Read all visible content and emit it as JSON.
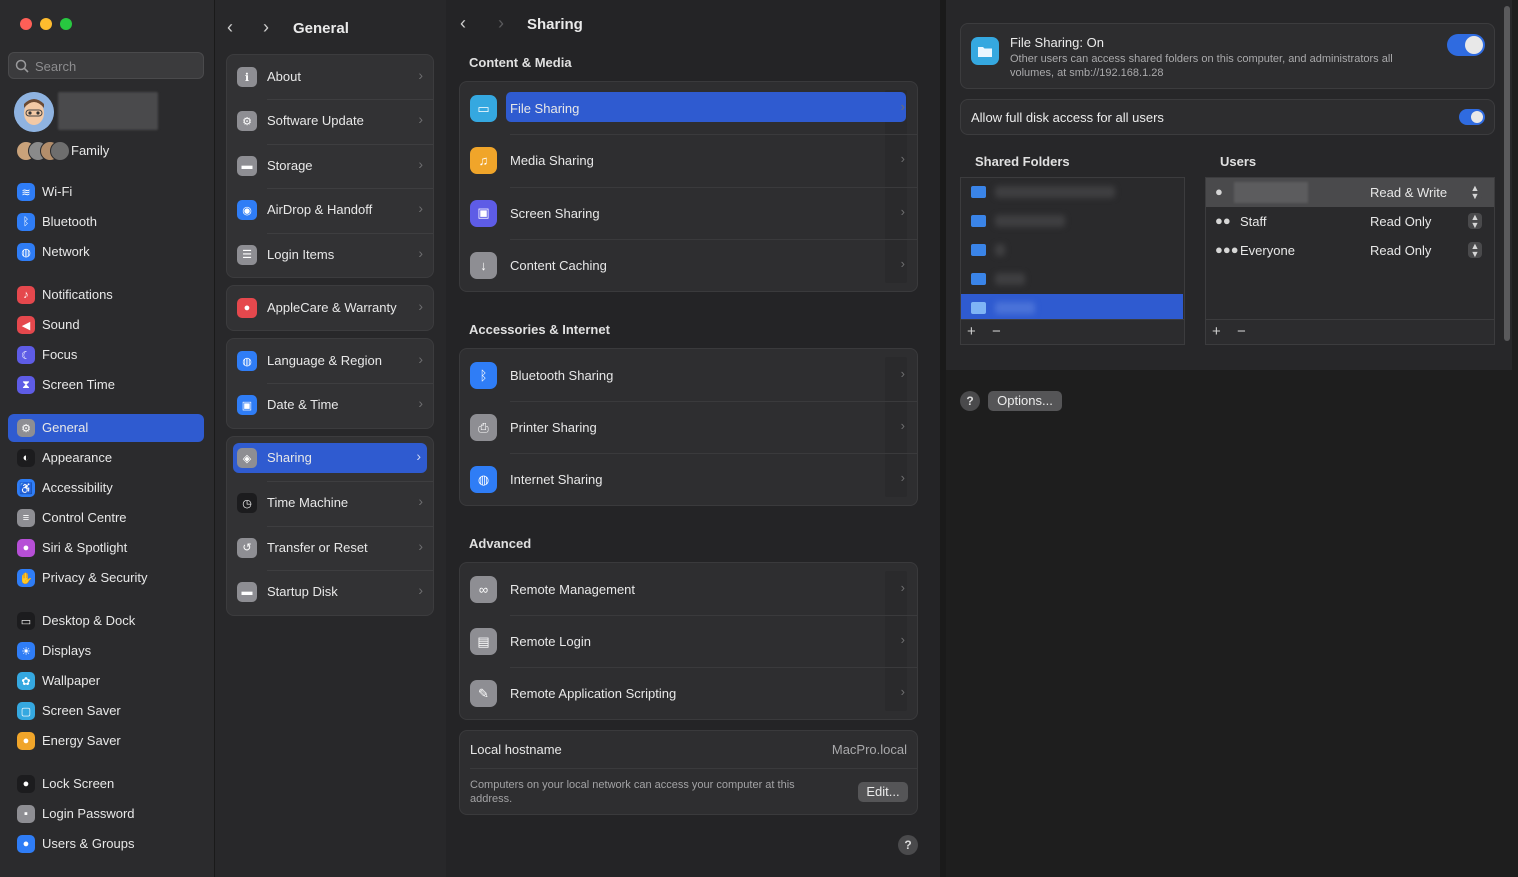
{
  "sidebar": {
    "search_placeholder": "Search",
    "family_label": "Family",
    "items": [
      {
        "label": "Wi-Fi",
        "icon": "wifi-icon",
        "color": "#2f7df6"
      },
      {
        "label": "Bluetooth",
        "icon": "bluetooth-icon",
        "color": "#2f7df6"
      },
      {
        "label": "Network",
        "icon": "globe-icon",
        "color": "#2f7df6"
      },
      {
        "label": "Notifications",
        "icon": "bell-icon",
        "color": "#e5484d"
      },
      {
        "label": "Sound",
        "icon": "speaker-icon",
        "color": "#e5484d"
      },
      {
        "label": "Focus",
        "icon": "moon-icon",
        "color": "#5e5ce6"
      },
      {
        "label": "Screen Time",
        "icon": "hourglass-icon",
        "color": "#5e5ce6"
      },
      {
        "label": "General",
        "icon": "gear-icon",
        "color": "#8e8e93"
      },
      {
        "label": "Appearance",
        "icon": "appearance-icon",
        "color": "#1c1c1e"
      },
      {
        "label": "Accessibility",
        "icon": "accessibility-icon",
        "color": "#2f7df6"
      },
      {
        "label": "Control Centre",
        "icon": "control-centre-icon",
        "color": "#8e8e93"
      },
      {
        "label": "Siri & Spotlight",
        "icon": "siri-icon",
        "color": "#b64fd6"
      },
      {
        "label": "Privacy & Security",
        "icon": "hand-icon",
        "color": "#2f7df6"
      },
      {
        "label": "Desktop & Dock",
        "icon": "dock-icon",
        "color": "#1c1c1e"
      },
      {
        "label": "Displays",
        "icon": "sun-icon",
        "color": "#2f7df6"
      },
      {
        "label": "Wallpaper",
        "icon": "flower-icon",
        "color": "#35a8e0"
      },
      {
        "label": "Screen Saver",
        "icon": "screen-saver-icon",
        "color": "#35a8e0"
      },
      {
        "label": "Energy Saver",
        "icon": "lightbulb-icon",
        "color": "#f0a52a"
      },
      {
        "label": "Lock Screen",
        "icon": "lock-icon",
        "color": "#1c1c1e"
      },
      {
        "label": "Login Password",
        "icon": "login-password-icon",
        "color": "#8e8e93"
      },
      {
        "label": "Users & Groups",
        "icon": "users-icon",
        "color": "#2f7df6"
      }
    ]
  },
  "general": {
    "title": "General",
    "items": [
      {
        "label": "About",
        "icon": "info-icon",
        "color": "#8e8e93"
      },
      {
        "label": "Software Update",
        "icon": "gear-badge-icon",
        "color": "#8e8e93"
      },
      {
        "label": "Storage",
        "icon": "drive-icon",
        "color": "#8e8e93"
      },
      {
        "label": "AirDrop & Handoff",
        "icon": "airdrop-icon",
        "color": "#2f7df6"
      },
      {
        "label": "Login Items",
        "icon": "list-icon",
        "color": "#8e8e93"
      },
      {
        "label": "AppleCare & Warranty",
        "icon": "apple-icon",
        "color": "#e5484d"
      },
      {
        "label": "Language & Region",
        "icon": "globe-icon",
        "color": "#2f7df6"
      },
      {
        "label": "Date & Time",
        "icon": "calendar-clock-icon",
        "color": "#2f7df6"
      },
      {
        "label": "Sharing",
        "icon": "sharing-icon",
        "color": "#8e8e93"
      },
      {
        "label": "Time Machine",
        "icon": "time-machine-icon",
        "color": "#1c1c1e"
      },
      {
        "label": "Transfer or Reset",
        "icon": "reset-icon",
        "color": "#8e8e93"
      },
      {
        "label": "Startup Disk",
        "icon": "drive-icon",
        "color": "#8e8e93"
      }
    ]
  },
  "sharing": {
    "title": "Sharing",
    "sections": [
      {
        "title": "Content & Media",
        "items": [
          {
            "label": "File Sharing",
            "icon": "folder-icon",
            "color": "#35a8e0"
          },
          {
            "label": "Media Sharing",
            "icon": "media-icon",
            "color": "#f0a52a"
          },
          {
            "label": "Screen Sharing",
            "icon": "screen-sharing-icon",
            "color": "#5e5ce6"
          },
          {
            "label": "Content Caching",
            "icon": "download-icon",
            "color": "#8e8e93"
          }
        ]
      },
      {
        "title": "Accessories & Internet",
        "items": [
          {
            "label": "Bluetooth Sharing",
            "icon": "bluetooth-icon",
            "color": "#2f7df6"
          },
          {
            "label": "Printer Sharing",
            "icon": "printer-icon",
            "color": "#8e8e93"
          },
          {
            "label": "Internet Sharing",
            "icon": "globe-icon",
            "color": "#2f7df6"
          }
        ]
      },
      {
        "title": "Advanced",
        "items": [
          {
            "label": "Remote Management",
            "icon": "binoculars-icon",
            "color": "#8e8e93"
          },
          {
            "label": "Remote Login",
            "icon": "terminal-icon",
            "color": "#8e8e93"
          },
          {
            "label": "Remote Application Scripting",
            "icon": "script-icon",
            "color": "#8e8e93"
          }
        ]
      }
    ],
    "hostname_label": "Local hostname",
    "hostname_value": "MacPro.local",
    "hostname_desc": "Computers on your local network can access your computer at this address.",
    "edit_label": "Edit..."
  },
  "file_sharing": {
    "title": "File Sharing: On",
    "description": "Other users can access shared folders on this computer, and administrators all volumes, at smb://192.168.1.28",
    "enabled": true,
    "full_disk_label": "Allow full disk access for all users",
    "full_disk_enabled": true,
    "shared_folders_label": "Shared Folders",
    "users_label": "Users",
    "users": [
      {
        "name": "",
        "permission": "Read & Write",
        "icon": "user-icon"
      },
      {
        "name": "Staff",
        "permission": "Read Only",
        "icon": "group-icon"
      },
      {
        "name": "Everyone",
        "permission": "Read Only",
        "icon": "everyone-icon"
      }
    ],
    "add_symbol": "+",
    "remove_symbol": "−",
    "options_label": "Options...",
    "help_symbol": "?"
  },
  "colors": {
    "accent": "#2f5bd0",
    "toggle": "#2f6be0"
  }
}
